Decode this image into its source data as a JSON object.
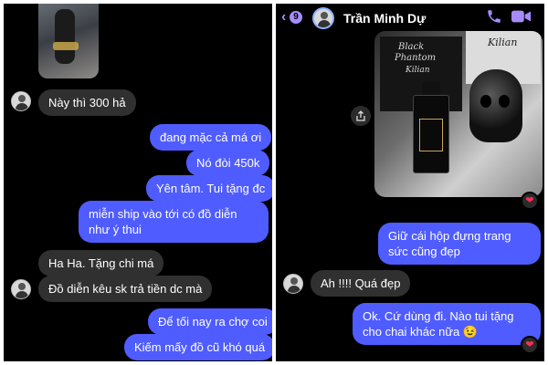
{
  "left": {
    "messages": [
      {
        "text": "Này thì 300 hả",
        "side": "in"
      },
      {
        "text": "đang mặc cả má ơi",
        "side": "out"
      },
      {
        "text": "Nó đòi 450k",
        "side": "out"
      },
      {
        "text": "Yên tâm. Tui tặng đc",
        "side": "out"
      },
      {
        "text": "miễn ship vào tới có đồ diễn như ý thui",
        "side": "out"
      },
      {
        "text": "Ha Ha. Tặng chi má",
        "side": "in"
      },
      {
        "text": "Đồ diễn kêu sk trả tiền dc mà",
        "side": "in"
      },
      {
        "text": "Để tối nay ra chợ coi",
        "side": "out"
      },
      {
        "text": "Kiếm mấy đồ cũ khó quá",
        "side": "out"
      }
    ]
  },
  "right": {
    "header": {
      "back_icon": "chevron-left-icon",
      "unread_count": "9",
      "contact_name": "Trần Minh Dự",
      "call_icon": "phone-icon",
      "video_icon": "video-camera-icon"
    },
    "photo": {
      "brand_lines": [
        "Black",
        "Phantom",
        "Kilian",
        "Kilian"
      ]
    },
    "messages": [
      {
        "text": "Giữ cái hộp đựng trang sức cũng đẹp",
        "side": "out"
      },
      {
        "text": "Ah !!!! Quá đẹp",
        "side": "in"
      },
      {
        "text": "Ok. Cứ dùng đi. Nào tui tặng cho chai khác nữa 😉",
        "side": "out"
      }
    ],
    "reactions": [
      "heart-icon",
      "heart-icon"
    ]
  },
  "colors": {
    "background": "#000000",
    "outgoing_bubble": "#4f5cff",
    "incoming_bubble": "#303030",
    "accent": "#a78bfa",
    "reaction": "#ff2d55"
  }
}
